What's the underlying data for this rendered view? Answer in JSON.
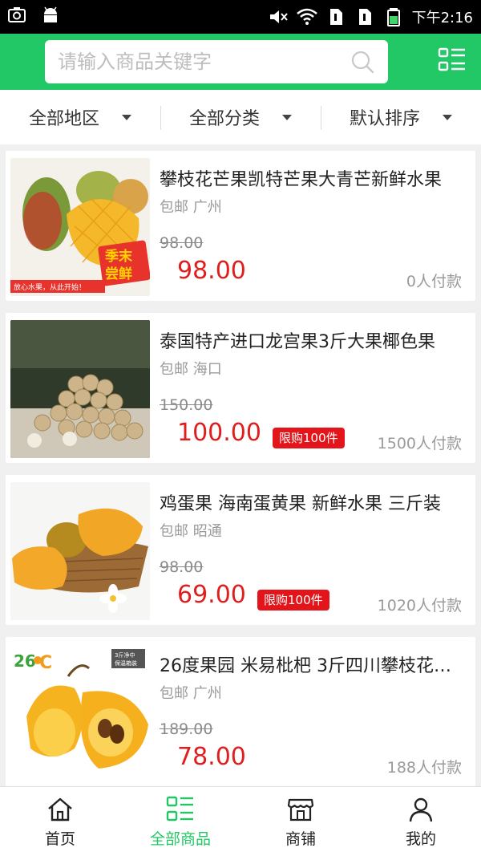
{
  "status_bar": {
    "time": "下午2:16",
    "icons": [
      "screenshot-icon",
      "android-icon",
      "mute-icon",
      "wifi-icon",
      "sim1-icon",
      "sim2-icon",
      "battery-icon"
    ]
  },
  "search": {
    "placeholder": "请输入商品关键字",
    "value": ""
  },
  "filters": [
    {
      "label": "全部地区"
    },
    {
      "label": "全部分类"
    },
    {
      "label": "默认排序"
    }
  ],
  "products": [
    {
      "title": "攀枝花芒果凯特芒果大青芒新鲜水果",
      "sub": "包邮 广州",
      "original_price": "98.00",
      "price": "98.00",
      "tag": "",
      "sales": "0人付款",
      "image_text": [
        "季末",
        "尝鲜",
        "放心水果，从此开始！"
      ]
    },
    {
      "title": "泰国特产进口龙宫果3斤大果椰色果",
      "sub": "包邮 海口",
      "original_price": "150.00",
      "price": "100.00",
      "tag": "限购100件",
      "sales": "1500人付款",
      "image_text": []
    },
    {
      "title": "鸡蛋果 海南蛋黄果 新鲜水果 三斤装",
      "sub": "包邮 昭通",
      "original_price": "98.00",
      "price": "69.00",
      "tag": "限购100件",
      "sales": "1020人付款",
      "image_text": []
    },
    {
      "title": "26度果园 米易枇杷 3斤四川攀枝花枇杷",
      "sub": "包邮 广州",
      "original_price": "189.00",
      "price": "78.00",
      "tag": "",
      "sales": "188人付款",
      "image_text": [
        "26",
        "C",
        "3斤净中",
        "保温箱装"
      ]
    }
  ],
  "nav": [
    {
      "label": "首页",
      "icon": "home-icon",
      "active": false
    },
    {
      "label": "全部商品",
      "icon": "grid-list-icon",
      "active": true
    },
    {
      "label": "商铺",
      "icon": "store-icon",
      "active": false
    },
    {
      "label": "我的",
      "icon": "user-icon",
      "active": false
    }
  ],
  "colors": {
    "brand_green": "#22c865",
    "price_red": "#e01e1e",
    "tag_red": "#e4141b"
  }
}
